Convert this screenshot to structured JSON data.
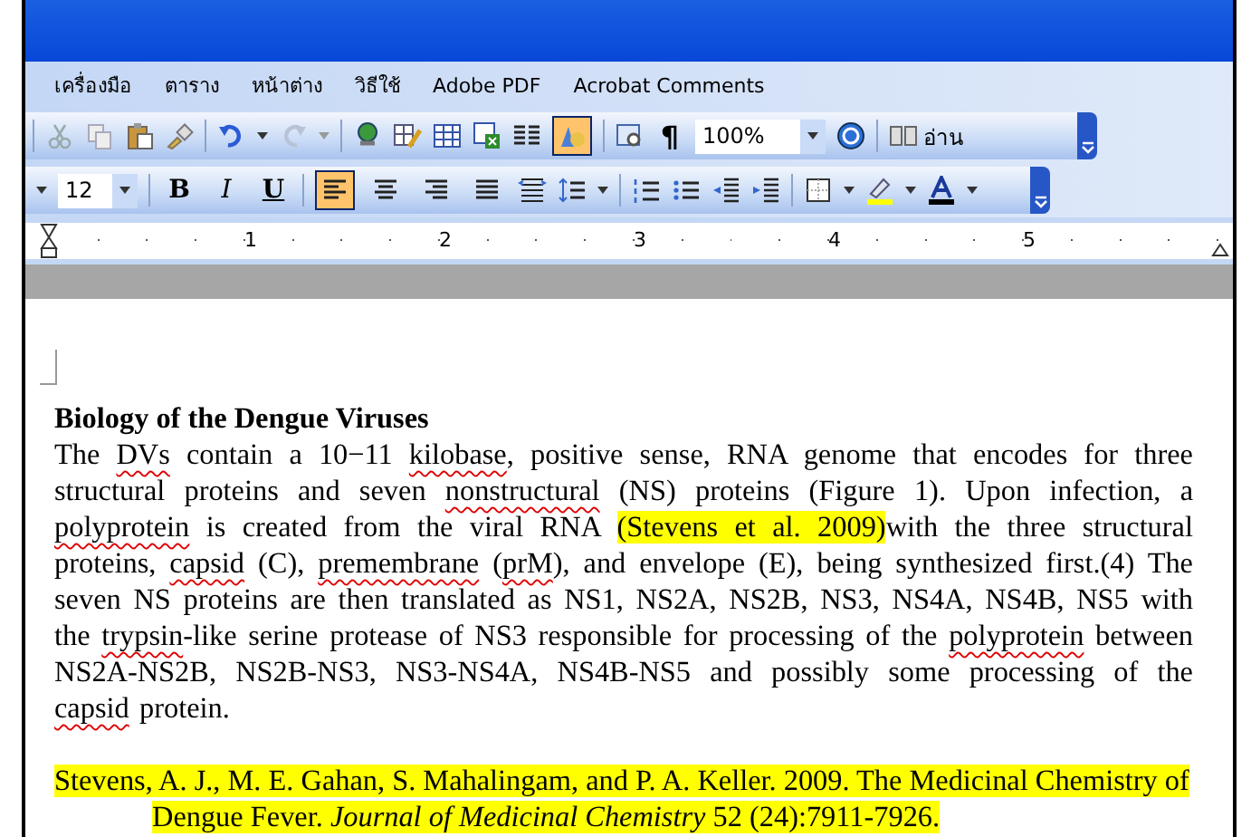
{
  "menu": [
    "เครื่องมือ",
    "ตาราง",
    "หน้าต่าง",
    "วิธีใช้",
    "Adobe PDF",
    "Acrobat Comments"
  ],
  "standard_toolbar": {
    "drawing_selected": true,
    "pilcrow": "¶",
    "zoom": "100%",
    "read_label": "อ่าน"
  },
  "formatting_toolbar": {
    "font_size": "12",
    "bold": "B",
    "italic": "I",
    "underline": "U",
    "align_buttons": [
      {
        "selected": true
      },
      {
        "selected": false
      },
      {
        "selected": false
      },
      {
        "selected": false
      }
    ]
  },
  "ruler": {
    "numbers": [
      "1",
      "2",
      "3",
      "4",
      "5"
    ]
  },
  "document": {
    "heading": "Biology of the Dengue Viruses",
    "paragraph": [
      {
        "text": "The ",
        "misspelled": false,
        "highlighted": false
      },
      {
        "text": "DVs",
        "misspelled": true,
        "highlighted": false
      },
      {
        "text": " contain a 10−11 ",
        "misspelled": false,
        "highlighted": false
      },
      {
        "text": "kilobase",
        "misspelled": true,
        "highlighted": false
      },
      {
        "text": ", positive sense, RNA genome that encodes for three structural proteins and seven ",
        "misspelled": false,
        "highlighted": false
      },
      {
        "text": "nonstructural",
        "misspelled": true,
        "highlighted": false
      },
      {
        "text": " (NS) proteins (Figure 1). Upon infection, a ",
        "misspelled": false,
        "highlighted": false
      },
      {
        "text": "polyprotein",
        "misspelled": true,
        "highlighted": false
      },
      {
        "text": " is created from the viral RNA ",
        "misspelled": false,
        "highlighted": false
      },
      {
        "text": "(Stevens et al. 2009)",
        "misspelled": false,
        "highlighted": true
      },
      {
        "text": "with the three structural proteins, ",
        "misspelled": false,
        "highlighted": false
      },
      {
        "text": "capsid",
        "misspelled": true,
        "highlighted": false
      },
      {
        "text": " (C), ",
        "misspelled": false,
        "highlighted": false
      },
      {
        "text": "premembrane",
        "misspelled": true,
        "highlighted": false
      },
      {
        "text": " (",
        "misspelled": false,
        "highlighted": false
      },
      {
        "text": "prM",
        "misspelled": true,
        "highlighted": false
      },
      {
        "text": "), and envelope (E), being synthesized first.(4) The seven NS proteins are then translated as NS1, NS2A, NS2B, NS3, NS4A, NS4B, NS5 with the ",
        "misspelled": false,
        "highlighted": false
      },
      {
        "text": "trypsin",
        "misspelled": true,
        "highlighted": false
      },
      {
        "text": "-like serine protease of NS3 responsible for processing of the ",
        "misspelled": false,
        "highlighted": false
      },
      {
        "text": "polyprotein",
        "misspelled": true,
        "highlighted": false
      },
      {
        "text": " between NS2A-NS2B, NS2B-NS3, NS3-NS4A, NS4B-NS5 and possibly some processing of the ",
        "misspelled": false,
        "highlighted": false
      },
      {
        "text": "capsid",
        "misspelled": true,
        "highlighted": false
      },
      {
        "text": " protein.",
        "misspelled": false,
        "highlighted": false
      }
    ],
    "reference": {
      "text": "Stevens, A. J., M. E. Gahan, S. Mahalingam, and P. A. Keller. 2009. The Medicinal Chemistry of Dengue Fever. *Journal of Medicinal Chemistry* 52 (24):7911-7926.",
      "highlighted": true
    }
  }
}
